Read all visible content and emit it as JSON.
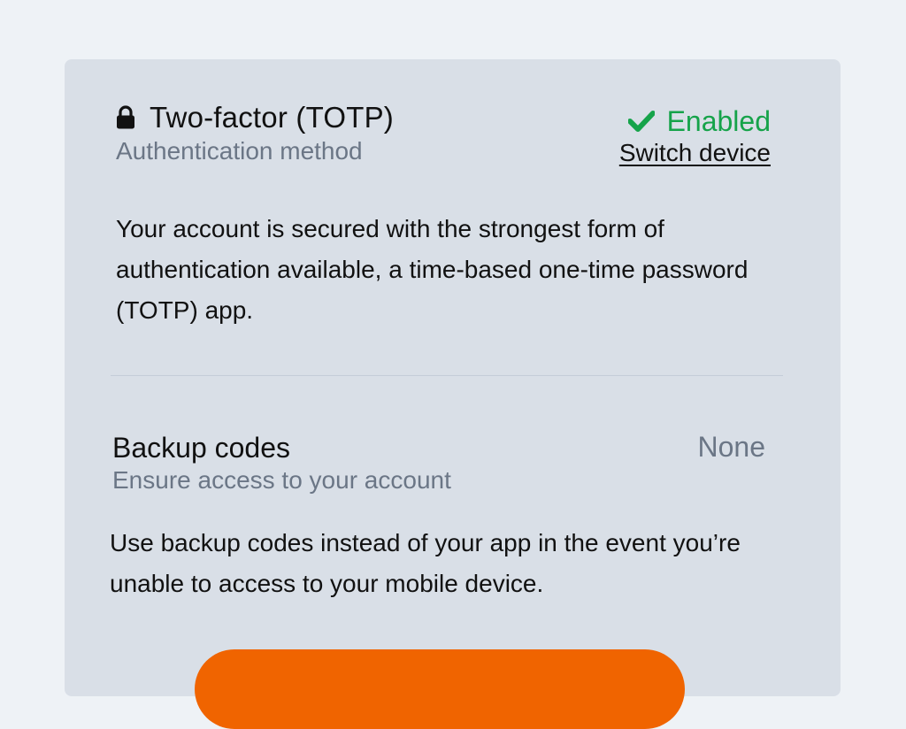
{
  "totp": {
    "title": "Two-factor (TOTP)",
    "subtitle": "Authentication method",
    "status_label": "Enabled",
    "switch_label": "Switch device",
    "description": "Your account is secured with the strongest form of authentication available, a time-based one-time password (TOTP) app."
  },
  "backup": {
    "title": "Backup codes",
    "subtitle": "Ensure access to your account",
    "status_label": "None",
    "description": "Use backup codes instead of your app in the event you’re unable to access to your mobile device."
  },
  "cta": {
    "label": ""
  },
  "colors": {
    "page_bg": "#eef2f6",
    "card_bg": "#d9dfe7",
    "accent_green": "#16a34a",
    "accent_orange": "#f06400",
    "muted_text": "#6b7686"
  },
  "icons": {
    "lock": "lock-icon",
    "check": "check-icon"
  }
}
